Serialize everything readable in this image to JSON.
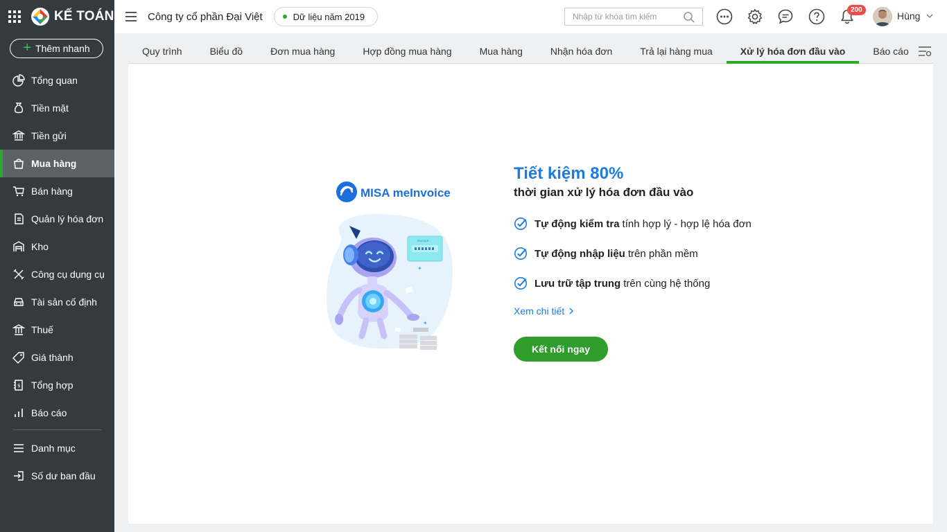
{
  "app": {
    "name": "KẾ TOÁN"
  },
  "sidebar": {
    "quick_add": "Thêm nhanh",
    "items": [
      {
        "label": "Tổng quan",
        "icon": "pie-chart-icon"
      },
      {
        "label": "Tiền mặt",
        "icon": "money-bag-icon"
      },
      {
        "label": "Tiền gửi",
        "icon": "bank-icon"
      },
      {
        "label": "Mua hàng",
        "icon": "shopping-bag-icon"
      },
      {
        "label": "Bán hàng",
        "icon": "cart-icon"
      },
      {
        "label": "Quản lý hóa đơn",
        "icon": "invoice-icon"
      },
      {
        "label": "Kho",
        "icon": "warehouse-icon"
      },
      {
        "label": "Công cụ dụng cụ",
        "icon": "tools-icon"
      },
      {
        "label": "Tài sản cố định",
        "icon": "car-icon"
      },
      {
        "label": "Thuế",
        "icon": "tax-icon"
      },
      {
        "label": "Giá thành",
        "icon": "price-tag-icon"
      },
      {
        "label": "Tổng hợp",
        "icon": "ledger-icon"
      },
      {
        "label": "Báo cáo",
        "icon": "bar-chart-icon"
      },
      {
        "label": "Danh mục",
        "icon": "list-icon"
      },
      {
        "label": "Số dư ban đầu",
        "icon": "login-icon"
      }
    ],
    "active_index": 3
  },
  "header": {
    "company": "Công ty cổ phần Đại Việt",
    "year": "Dữ liệu năm 2019",
    "search_placeholder": "Nhập từ khóa tìm kiếm",
    "notification_count": "200",
    "username": "Hùng"
  },
  "tabs": [
    "Quy trình",
    "Biểu đồ",
    "Đơn mua hàng",
    "Hợp đồng mua hàng",
    "Mua hàng",
    "Nhận hóa đơn",
    "Trả lại hàng mua",
    "Xử lý hóa đơn đầu vào",
    "Báo cáo"
  ],
  "active_tab": "Xử lý hóa đơn đầu vào",
  "promo": {
    "brand": "MISA meInvoice",
    "headline": "Tiết kiệm 80%",
    "subheadline": "thời gian xử lý hóa đơn đầu vào",
    "bullets": [
      {
        "bold": "Tự động kiểm tra",
        "rest": "tính hợp lý - hợp lệ hóa đơn"
      },
      {
        "bold": "Tự động nhập liệu",
        "rest": "trên phần mềm"
      },
      {
        "bold": "Lưu trữ tập trung",
        "rest": "trên cùng hệ thống"
      }
    ],
    "link": "Xem chi tiết",
    "cta": "Kết nối ngay",
    "illustration_label": "INVOICE"
  },
  "colors": {
    "sidebar_bg": "#333a40",
    "accent_green": "#2ea82a",
    "accent_blue": "#1b7be0",
    "badge_red": "#ef4b4b"
  }
}
